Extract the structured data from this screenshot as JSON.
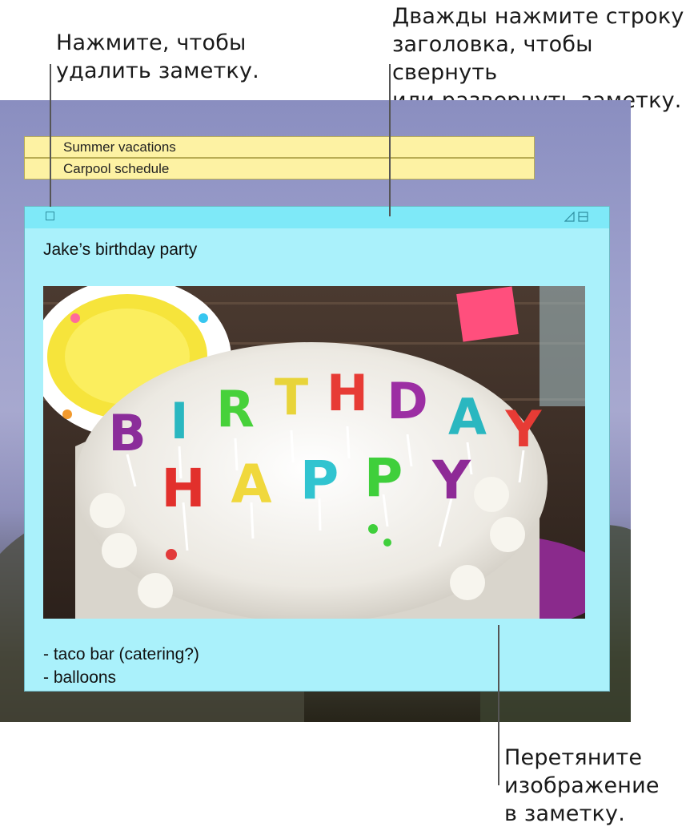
{
  "callouts": {
    "delete": "Нажмите, чтобы\nудалить заметку.",
    "titlebar": "Дважды нажмите строку\nзаголовка, чтобы свернуть\nили развернуть заметку.",
    "drag": "Перетяните\nизображение\nв заметку."
  },
  "yellow_notes": [
    "Summer vacations",
    "Carpool schedule"
  ],
  "note": {
    "title": "Jake’s birthday party",
    "image_letters_top": [
      "B",
      "I",
      "R",
      "T",
      "H",
      "D",
      "A",
      "Y"
    ],
    "image_letters_bottom": [
      "H",
      "A",
      "P",
      "P",
      "Y"
    ],
    "body": [
      "- taco bar (catering?)",
      "- balloons"
    ],
    "colors": {
      "note_bg": "#aaf1fb",
      "titlebar": "#7ee9f8",
      "yellow_note": "#fdf2a3"
    }
  }
}
